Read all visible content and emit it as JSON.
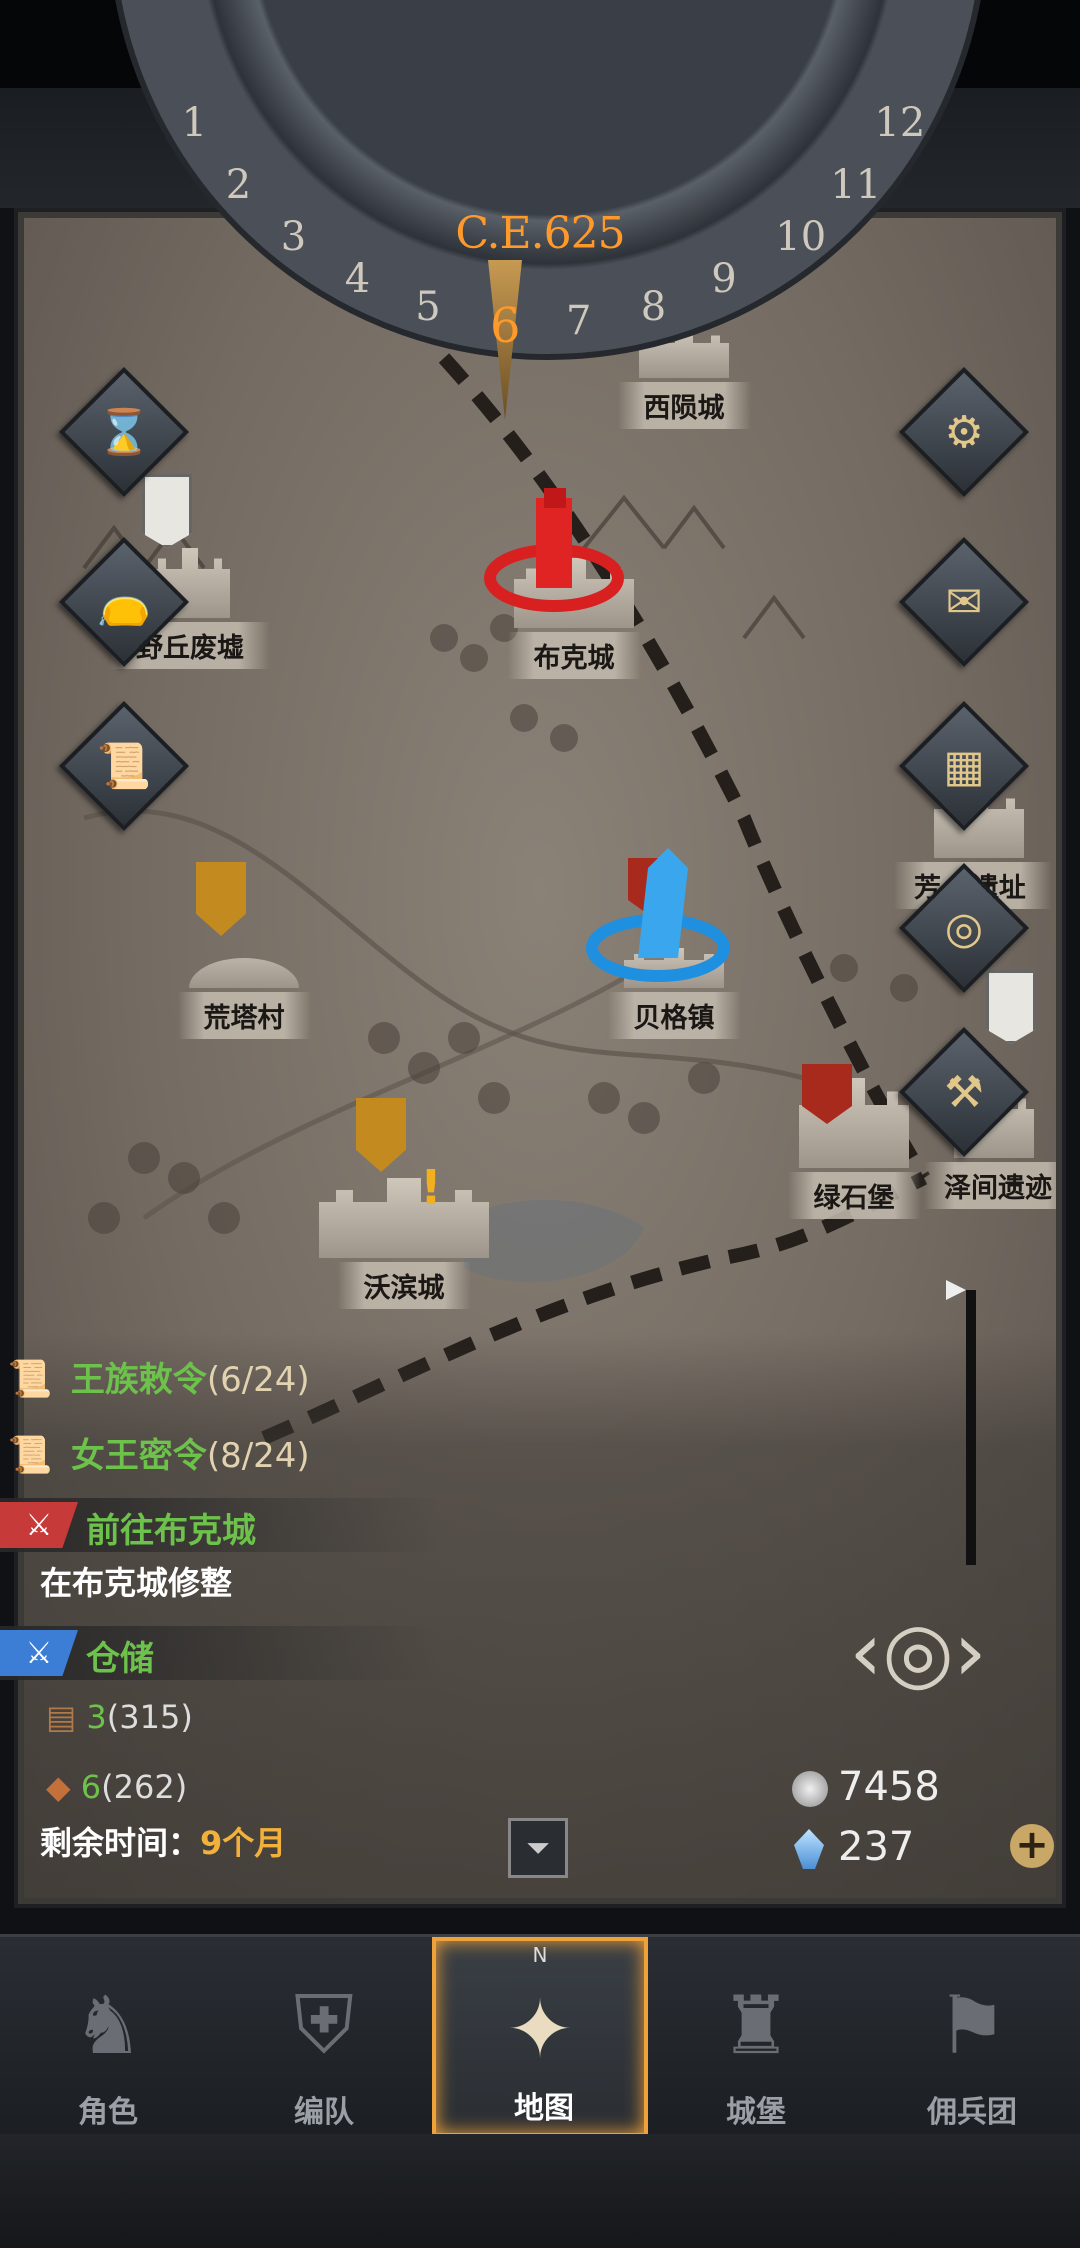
{
  "calendar": {
    "year": "C.E.625",
    "months": [
      "1",
      "2",
      "3",
      "4",
      "5",
      "6",
      "7",
      "8",
      "9",
      "10",
      "11",
      "12"
    ],
    "current_month": "6"
  },
  "map": {
    "places": {
      "yeqiu": "野丘废墟",
      "buke": "布克城",
      "xiyin": "西陨城",
      "huangta": "荒塔村",
      "beige": "贝格镇",
      "woobin": "沃滨城",
      "lvshi": "绿石堡",
      "zejian": "泽间遗迹",
      "right_partial": "芳...遗址"
    }
  },
  "quests": [
    {
      "name": "王族敕令",
      "count": "(6/24)"
    },
    {
      "name": "女王密令",
      "count": "(8/24)"
    }
  ],
  "tasks": {
    "task1_title": "前往布克城",
    "task1_desc": "在布克城修整",
    "task2_title": "仓储"
  },
  "resources": {
    "wood_value": "3",
    "wood_cap": "(315)",
    "ore_value": "6",
    "ore_cap": "(262)"
  },
  "timer": {
    "label": "剩余时间：",
    "value": "9个月"
  },
  "currency": {
    "silver": "7458",
    "crystal": "237"
  },
  "nav": {
    "role": "角色",
    "team": "编队",
    "map": "地图",
    "castle": "城堡",
    "mercenary": "佣兵团",
    "compass_n": "N"
  },
  "colors": {
    "accent": "#ff9a2a",
    "quest_green": "#6cc24a",
    "active_tab": "#f0a23a"
  }
}
